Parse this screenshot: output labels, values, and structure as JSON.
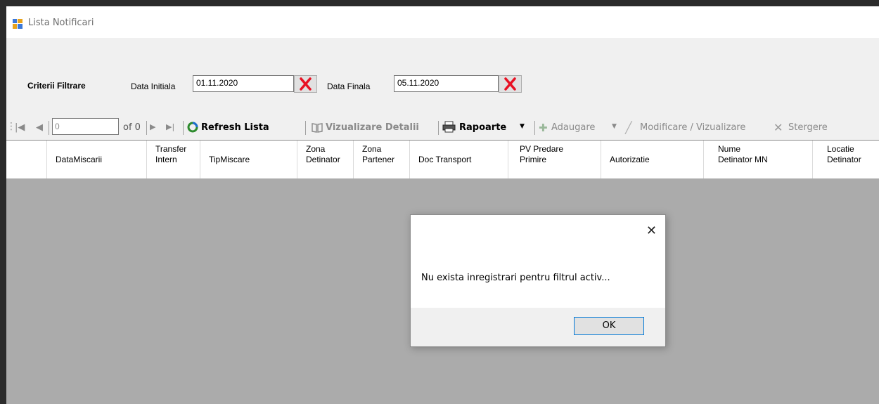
{
  "window": {
    "title": "Lista Notificari"
  },
  "filters": {
    "section_label": "Criterii Filtrare",
    "start_label": "Data Initiala",
    "start_value": "01.11.2020",
    "end_label": "Data Finala",
    "end_value": "05.11.2020"
  },
  "navigator": {
    "position": "0",
    "count": "of 0"
  },
  "toolbar": {
    "refresh": "Refresh Lista",
    "details": "Vizualizare Detalii",
    "reports": "Rapoarte",
    "add": "Adaugare",
    "edit": "Modificare / Vizualizare",
    "delete": "Stergere"
  },
  "grid": {
    "columns": [
      "DataMiscarii",
      "Transfer\nIntern",
      "TipMiscare",
      "Zona\nDetinator",
      "Zona\nPartener",
      "Doc Transport",
      "PV Predare\nPrimire",
      "Autorizatie",
      "Nume\nDetinator MN",
      "Locatie\nDetinator"
    ],
    "rows": []
  },
  "dialog": {
    "message": "Nu exista inregistrari pentru filtrul activ...",
    "ok_label": "OK",
    "close_glyph": "✕"
  },
  "colors": {
    "grid_empty_bg": "#ababab",
    "clear_icon": "#e81123",
    "accent": "#0078d7"
  }
}
